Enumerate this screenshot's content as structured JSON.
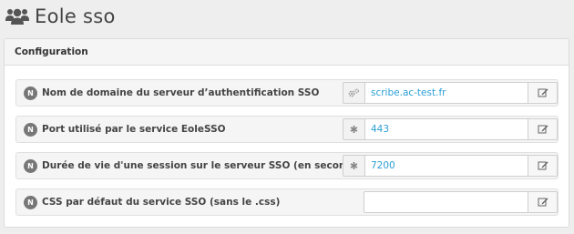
{
  "page": {
    "title": "Eole sso",
    "title_icon": "users-icon"
  },
  "panel": {
    "heading": "Configuration"
  },
  "rows": [
    {
      "badge": "N",
      "label": "Nom de domaine du serveur d’authentification SSO",
      "addon_icon": "cogs-icon",
      "value": "scribe.ac-test.fr",
      "edit_icon": "edit-icon"
    },
    {
      "badge": "N",
      "label": "Port utilisé par le service EoleSSO",
      "addon_icon": "asterisk-icon",
      "value": "443",
      "edit_icon": "edit-icon"
    },
    {
      "badge": "N",
      "label": "Durée de vie d'une session sur le serveur SSO (en secondes)",
      "addon_icon": "asterisk-icon",
      "value": "7200",
      "edit_icon": "edit-icon"
    },
    {
      "badge": "N",
      "label": "CSS par défaut du service SSO (sans le .css)",
      "addon_icon": "",
      "value": "",
      "edit_icon": "edit-icon"
    }
  ],
  "colors": {
    "value_text": "#2a9fd6",
    "badge": "#777777",
    "panel_header_bg": "#f5f5f5"
  }
}
